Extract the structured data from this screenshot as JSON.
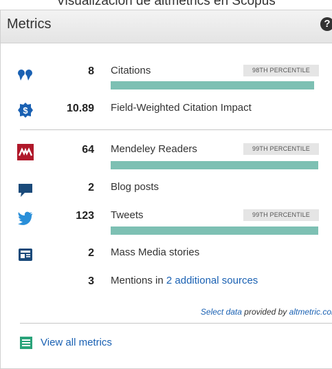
{
  "caption": "Visualización de altmetrics en Scopus",
  "panel": {
    "title": "Metrics"
  },
  "colors": {
    "bar": "#7dc0b3",
    "link": "#1a61b3",
    "badge_bg": "#e5e5e5"
  },
  "metrics": [
    {
      "icon": "quote-icon",
      "value": "8",
      "label": "Citations",
      "percentile": "98TH PERCENTILE",
      "bar_fraction": 0.98
    },
    {
      "icon": "fwci-icon",
      "value": "10.89",
      "label": "Field-Weighted Citation Impact"
    },
    {
      "icon": "mendeley-icon",
      "value": "64",
      "label": "Mendeley Readers",
      "percentile": "99TH PERCENTILE",
      "bar_fraction": 1.0
    },
    {
      "icon": "blog-icon",
      "value": "2",
      "label": "Blog posts"
    },
    {
      "icon": "twitter-icon",
      "value": "123",
      "label": "Tweets",
      "percentile": "99TH PERCENTILE",
      "bar_fraction": 1.0
    },
    {
      "icon": "news-icon",
      "value": "2",
      "label": "Mass Media stories"
    },
    {
      "value": "3",
      "label": "Mentions in ",
      "link": "2 additional sources"
    }
  ],
  "footer": {
    "select_data": "Select data",
    "provided_by": " provided by ",
    "source": "altmetric.com"
  },
  "view_all": "View all metrics"
}
